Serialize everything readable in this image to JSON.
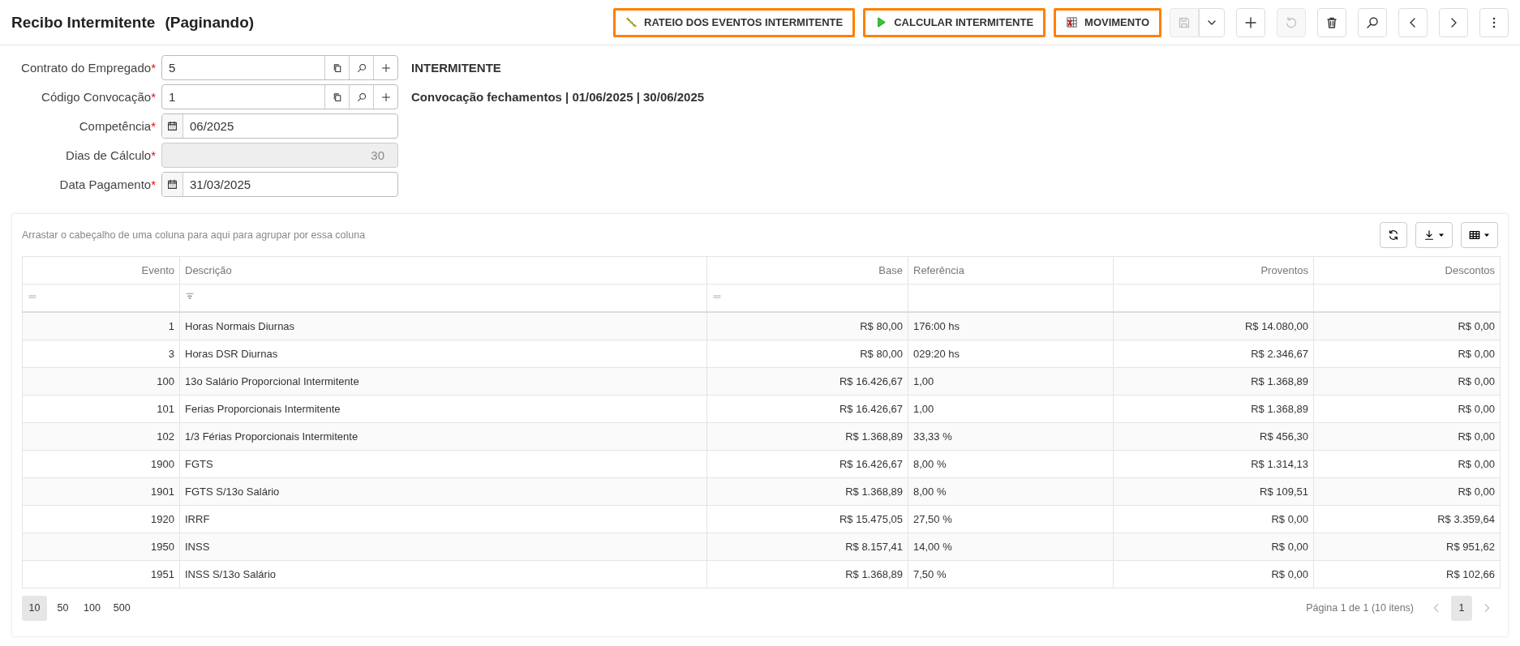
{
  "page": {
    "title": "Recibo Intermitente",
    "subtitle": "(Paginando)"
  },
  "toolbar": {
    "actions": [
      {
        "label": "RATEIO DOS EVENTOS INTERMITENTE",
        "kind": "rateio",
        "highlighted": true
      },
      {
        "label": "CALCULAR INTERMITENTE",
        "kind": "play",
        "highlighted": true
      },
      {
        "label": "MOVIMENTO",
        "kind": "grid",
        "highlighted": true
      }
    ],
    "icon_buttons": [
      {
        "kind": "save",
        "disabled": true
      },
      {
        "kind": "caret",
        "disabled": false
      },
      {
        "kind": "plus",
        "disabled": false
      },
      {
        "kind": "undo",
        "disabled": true
      },
      {
        "kind": "trash",
        "disabled": false
      },
      {
        "kind": "search",
        "disabled": false
      },
      {
        "kind": "prev",
        "disabled": false
      },
      {
        "kind": "next",
        "disabled": false
      },
      {
        "kind": "more",
        "disabled": false
      }
    ]
  },
  "form": {
    "fields": [
      {
        "label": "Contrato do Empregado",
        "required_mark": "*",
        "kind": "lookup",
        "value": "5",
        "disabled": false
      },
      {
        "label": "Código Convocação",
        "required_mark": "*",
        "kind": "lookup",
        "value": "1",
        "disabled": false
      },
      {
        "label": "Competência",
        "required_mark": "*",
        "kind": "date",
        "value": "06/2025",
        "disabled": false
      },
      {
        "label": "Dias de Cálculo",
        "required_mark": "*",
        "kind": "number",
        "value": "30",
        "disabled": true
      },
      {
        "label": "Data Pagamento",
        "required_mark": "*",
        "kind": "date",
        "value": "31/03/2025",
        "disabled": false
      }
    ],
    "info": [
      "INTERMITENTE",
      "Convocação fechamentos | 01/06/2025 | 30/06/2025"
    ]
  },
  "grid": {
    "group_hint": "Arrastar o cabeçalho de uma coluna para aqui para agrupar por essa coluna",
    "tools": [
      {
        "kind": "refresh"
      },
      {
        "kind": "download"
      },
      {
        "kind": "columns"
      }
    ],
    "columns": [
      {
        "label": "Evento",
        "kind": "code"
      },
      {
        "label": "Descrição",
        "kind": "text"
      },
      {
        "label": "Base",
        "kind": "money"
      },
      {
        "label": "Referência",
        "kind": "reference"
      },
      {
        "label": "Proventos",
        "kind": "total"
      },
      {
        "label": "Descontos",
        "kind": "total"
      }
    ],
    "rows": [
      [
        "1",
        "Horas Normais Diurnas",
        "R$ 80,00",
        "176:00 hs",
        "R$ 14.080,00",
        "R$ 0,00"
      ],
      [
        "3",
        "Horas DSR Diurnas",
        "R$ 80,00",
        "029:20 hs",
        "R$ 2.346,67",
        "R$ 0,00"
      ],
      [
        "100",
        "13o Salário Proporcional Intermitente",
        "R$ 16.426,67",
        "1,00",
        "R$ 1.368,89",
        "R$ 0,00"
      ],
      [
        "101",
        "Ferias Proporcionais Intermitente",
        "R$ 16.426,67",
        "1,00",
        "R$ 1.368,89",
        "R$ 0,00"
      ],
      [
        "102",
        "1/3 Férias Proporcionais Intermitente",
        "R$ 1.368,89",
        "33,33 %",
        "R$ 456,30",
        "R$ 0,00"
      ],
      [
        "1900",
        "FGTS",
        "R$ 16.426,67",
        "8,00 %",
        "R$ 1.314,13",
        "R$ 0,00"
      ],
      [
        "1901",
        "FGTS S/13o Salário",
        "R$ 1.368,89",
        "8,00 %",
        "R$ 109,51",
        "R$ 0,00"
      ],
      [
        "1920",
        "IRRF",
        "R$ 15.475,05",
        "27,50 %",
        "R$ 0,00",
        "R$ 3.359,64"
      ],
      [
        "1950",
        "INSS",
        "R$ 8.157,41",
        "14,00 %",
        "R$ 0,00",
        "R$ 951,62"
      ],
      [
        "1951",
        "INSS S/13o Salário",
        "R$ 1.368,89",
        "7,50 %",
        "R$ 0,00",
        "R$ 102,66"
      ]
    ],
    "pager": {
      "sizes": [
        {
          "label": "10",
          "selected": true
        },
        {
          "label": "50",
          "selected": false
        },
        {
          "label": "100",
          "selected": false
        },
        {
          "label": "500",
          "selected": false
        }
      ],
      "info": "Página 1 de 1 (10 itens)",
      "pages": [
        {
          "label": "1",
          "selected": true
        }
      ],
      "prev_disabled": true,
      "next_disabled": true
    }
  }
}
